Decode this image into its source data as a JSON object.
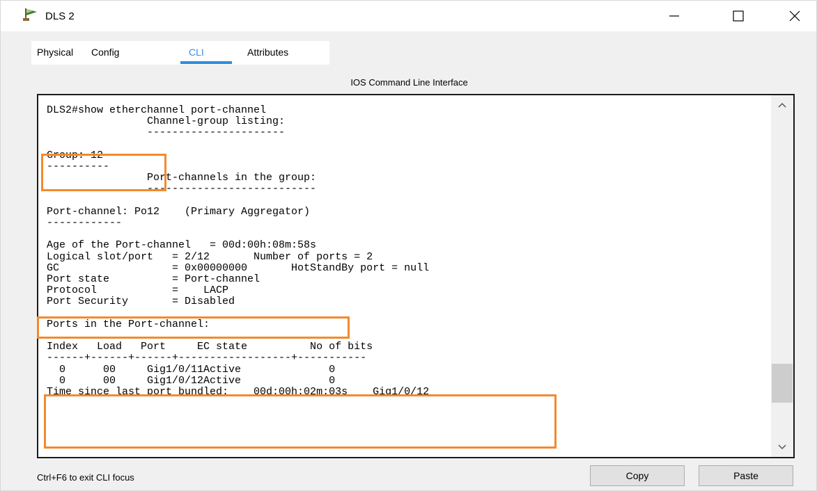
{
  "window": {
    "title": "DLS 2",
    "icon": "packet-tracer-device-icon"
  },
  "tabs": [
    {
      "label": "Physical",
      "active": false
    },
    {
      "label": "Config",
      "active": false
    },
    {
      "label": "CLI",
      "active": true
    },
    {
      "label": "Attributes",
      "active": false
    }
  ],
  "panel_title": "IOS Command Line Interface",
  "console": {
    "lines": [
      "DLS2#show etherchannel port-channel",
      "                Channel-group listing:",
      "                ----------------------",
      "",
      "Group: 12",
      "----------",
      "                Port-channels in the group:",
      "                ---------------------------",
      "",
      "Port-channel: Po12    (Primary Aggregator)",
      "------------",
      "",
      "Age of the Port-channel   = 00d:00h:08m:58s",
      "Logical slot/port   = 2/12       Number of ports = 2",
      "GC                  = 0x00000000       HotStandBy port = null",
      "Port state          = Port-channel",
      "Protocol            =    LACP",
      "Port Security       = Disabled",
      "",
      "Ports in the Port-channel:",
      "",
      "Index   Load   Port     EC state          No of bits",
      "------+------+------+------------------+-----------",
      "  0      00     Gig1/0/11Active              0",
      "  0      00     Gig1/0/12Active              0",
      "Time since last port bundled:    00d:00h:02m:03s    Gig1/0/12"
    ]
  },
  "footer": {
    "focus_hint": "Ctrl+F6 to exit CLI focus",
    "copy_label": "Copy",
    "paste_label": "Paste"
  },
  "colors": {
    "highlight": "#f38a2c",
    "active_tab": "#2a8ee0"
  }
}
